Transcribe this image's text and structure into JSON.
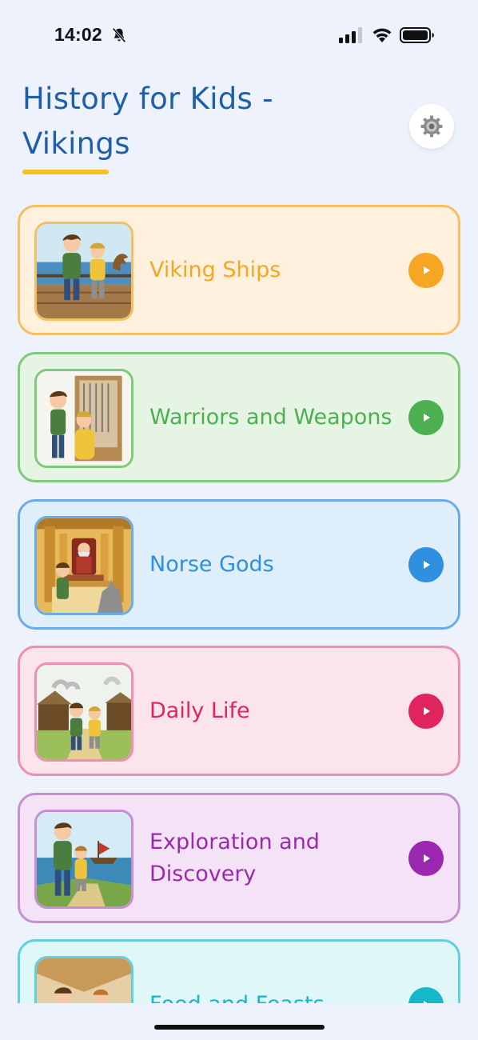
{
  "status_bar": {
    "time": "14:02"
  },
  "header": {
    "title": "History for Kids - Vikings"
  },
  "colors": {
    "background": "#eef2fc",
    "title": "#1e5fa9",
    "underline": "#f5c21a"
  },
  "cards": [
    {
      "label": "Viking Ships",
      "color": "#f5a623",
      "bg": "#fff1de",
      "border": "#f6bf63",
      "play_icon": "play-icon"
    },
    {
      "label": "Warriors and Weapons",
      "color": "#4caf50",
      "bg": "#e6f4e4",
      "border": "#7ec97a",
      "play_icon": "play-icon"
    },
    {
      "label": "Norse Gods",
      "color": "#2f8fe0",
      "bg": "#dfeefb",
      "border": "#6aade6",
      "play_icon": "play-icon"
    },
    {
      "label": "Daily Life",
      "color": "#e0245e",
      "bg": "#fce4ec",
      "border": "#ee8fb0",
      "play_icon": "play-icon"
    },
    {
      "label": "Exploration and Discovery",
      "color": "#9c27b0",
      "bg": "#f4e3f6",
      "border": "#c78ed3",
      "play_icon": "play-icon"
    },
    {
      "label": "Food and Feasts",
      "color": "#14b8c8",
      "bg": "#e0f7fa",
      "border": "#62d0dc",
      "play_icon": "play-icon"
    }
  ]
}
